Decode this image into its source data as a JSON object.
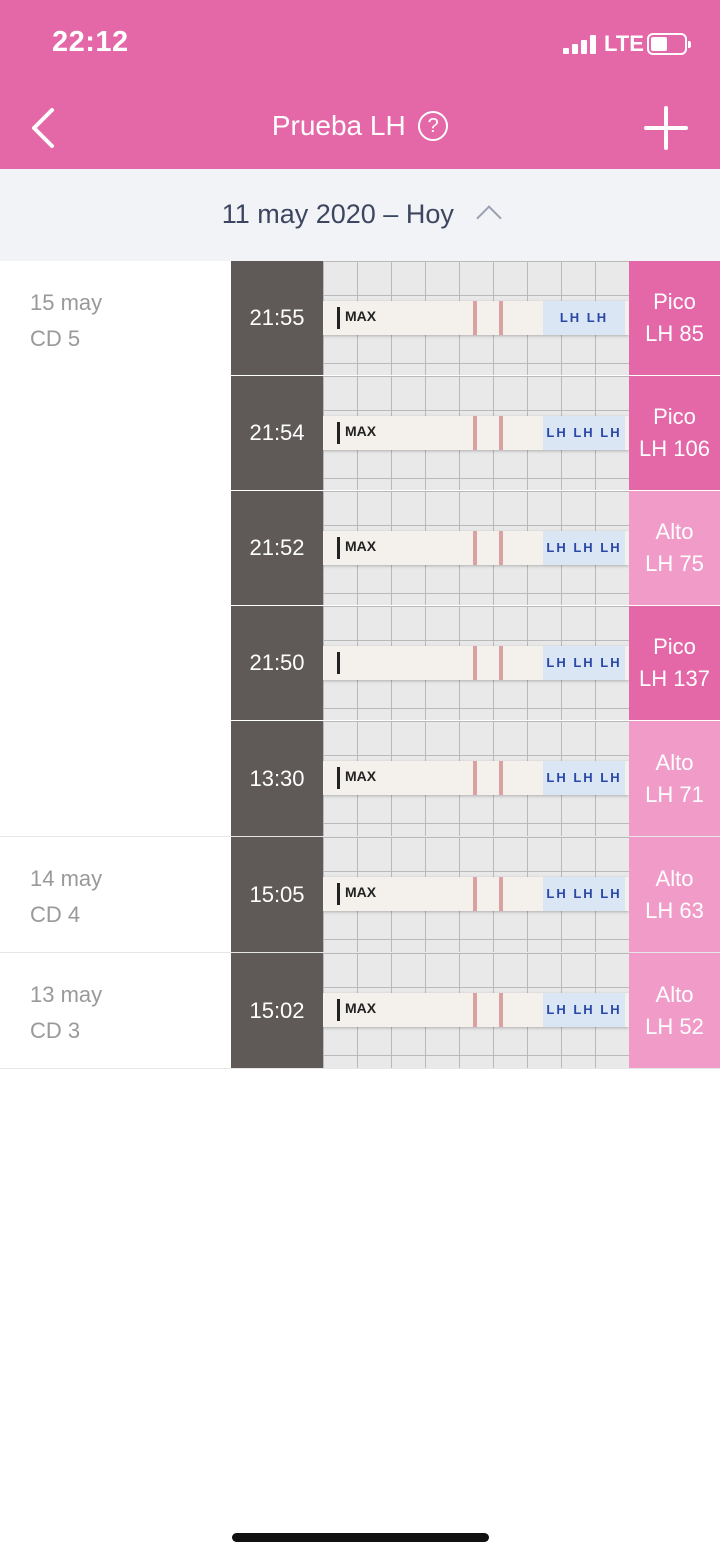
{
  "status": {
    "time": "22:12",
    "network": "LTE"
  },
  "header": {
    "title": "Prueba LH",
    "help_label": "?"
  },
  "range": {
    "label": "11 may 2020 – Hoy"
  },
  "colors": {
    "accent": "#e467a8",
    "peak": "#e467a8",
    "high": "#f09bc8"
  },
  "icons": {
    "back": "chevron-left-icon",
    "add": "plus-icon",
    "help": "question-circle-icon",
    "collapse": "chevron-up-icon"
  },
  "groups": [
    {
      "date": "15 may",
      "cd": "CD 5",
      "tests": [
        {
          "time": "21:55",
          "level": "Pico",
          "lh": "LH 85",
          "kind": "peak",
          "strip_text": "MAX",
          "lh_text": "LH LH"
        },
        {
          "time": "21:54",
          "level": "Pico",
          "lh": "LH 106",
          "kind": "peak",
          "strip_text": "MAX",
          "lh_text": "LH LH LH"
        },
        {
          "time": "21:52",
          "level": "Alto",
          "lh": "LH 75",
          "kind": "high",
          "strip_text": "MAX",
          "lh_text": "LH LH LH"
        },
        {
          "time": "21:50",
          "level": "Pico",
          "lh": "LH 137",
          "kind": "peak",
          "strip_text": "",
          "lh_text": "LH LH LH"
        },
        {
          "time": "13:30",
          "level": "Alto",
          "lh": "LH 71",
          "kind": "high",
          "strip_text": "MAX",
          "lh_text": "LH LH LH"
        }
      ]
    },
    {
      "date": "14 may",
      "cd": "CD 4",
      "tests": [
        {
          "time": "15:05",
          "level": "Alto",
          "lh": "LH 63",
          "kind": "high",
          "strip_text": "MAX",
          "lh_text": "LH LH LH"
        }
      ]
    },
    {
      "date": "13 may",
      "cd": "CD 3",
      "tests": [
        {
          "time": "15:02",
          "level": "Alto",
          "lh": "LH 52",
          "kind": "high",
          "strip_text": "MAX",
          "lh_text": "LH LH LH"
        }
      ]
    }
  ]
}
